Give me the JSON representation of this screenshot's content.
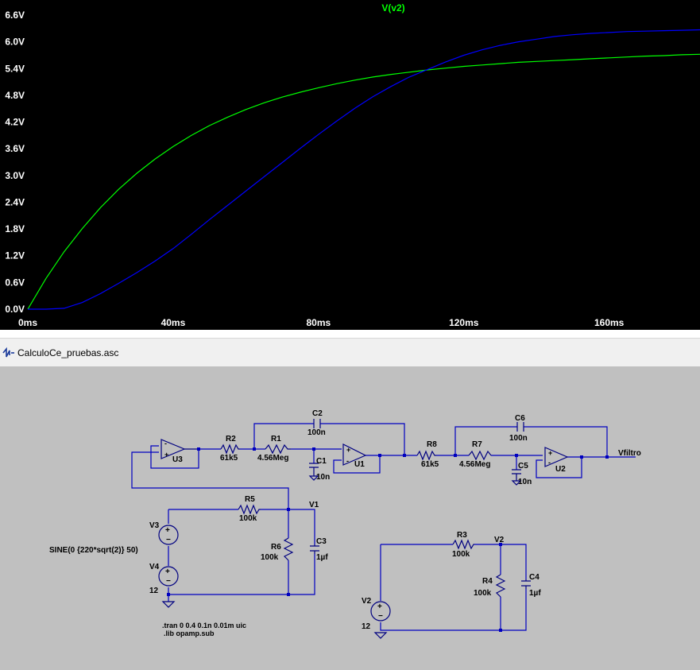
{
  "waveform": {
    "trace_title": "V(v2)",
    "background": "#000000",
    "trace_title_color": "#00ff00",
    "chart_data": {
      "type": "line",
      "title": "V(v2)",
      "xlabel": "",
      "ylabel": "",
      "xlim": [
        0,
        185
      ],
      "ylim": [
        0,
        6.6
      ],
      "x_ticks": [
        "0ms",
        "40ms",
        "80ms",
        "120ms",
        "160ms"
      ],
      "y_ticks": [
        "0.0V",
        "0.6V",
        "1.2V",
        "1.8V",
        "2.4V",
        "3.0V",
        "3.6V",
        "4.2V",
        "4.8V",
        "5.4V",
        "6.0V",
        "6.6V"
      ],
      "grid": false,
      "series": [
        {
          "color": "#00ff00",
          "x": [
            0,
            5,
            10,
            15,
            20,
            25,
            30,
            35,
            40,
            45,
            50,
            55,
            60,
            65,
            70,
            75,
            80,
            85,
            90,
            95,
            100,
            105,
            110,
            115,
            120,
            125,
            130,
            135,
            140,
            145,
            150,
            155,
            160,
            165,
            170,
            175,
            180,
            185
          ],
          "values": [
            0,
            0.69,
            1.29,
            1.81,
            2.28,
            2.69,
            3.05,
            3.37,
            3.65,
            3.9,
            4.12,
            4.31,
            4.48,
            4.63,
            4.76,
            4.87,
            4.97,
            5.06,
            5.14,
            5.21,
            5.27,
            5.32,
            5.37,
            5.41,
            5.45,
            5.48,
            5.51,
            5.54,
            5.56,
            5.58,
            5.6,
            5.62,
            5.64,
            5.66,
            5.68,
            5.69,
            5.71,
            5.72
          ]
        },
        {
          "color": "#0000ff",
          "x": [
            0,
            5,
            10,
            15,
            20,
            25,
            30,
            35,
            40,
            45,
            50,
            55,
            60,
            65,
            70,
            75,
            80,
            85,
            90,
            95,
            100,
            105,
            110,
            115,
            120,
            125,
            130,
            135,
            140,
            145,
            150,
            155,
            160,
            165,
            170,
            175,
            180,
            185
          ],
          "values": [
            0,
            0,
            0.02,
            0.15,
            0.35,
            0.58,
            0.82,
            1.08,
            1.36,
            1.68,
            2.01,
            2.33,
            2.65,
            2.97,
            3.29,
            3.61,
            3.92,
            4.22,
            4.51,
            4.77,
            5.0,
            5.21,
            5.38,
            5.55,
            5.7,
            5.82,
            5.92,
            6.0,
            6.06,
            6.12,
            6.16,
            6.19,
            6.21,
            6.23,
            6.24,
            6.25,
            6.26,
            6.27
          ]
        }
      ]
    }
  },
  "tab": {
    "icon": "waveform-icon",
    "title": "CalculoCe_pruebas.asc"
  },
  "schematic": {
    "components": {
      "u3": "U3",
      "u1": "U1",
      "u2": "U2",
      "r2": "R2",
      "r2_val": "61k5",
      "r1": "R1",
      "r1_val": "4.56Meg",
      "c2": "C2",
      "c2_val": "100n",
      "c1": "C1",
      "c1_val": "10n",
      "r8": "R8",
      "r8_val": "61k5",
      "r7": "R7",
      "r7_val": "4.56Meg",
      "c6": "C6",
      "c6_val": "100n",
      "c5": "C5",
      "c5_val": "10n",
      "r5": "R5",
      "r5_val": "100k",
      "r6": "R6",
      "r6_val": "100k",
      "c3": "C3",
      "c3_val": "1µf",
      "v3": "V3",
      "v3_val": "SINE(0 {220*sqrt(2)} 50)",
      "v4": "V4",
      "v4_val": "12",
      "r3": "R3",
      "r3_val": "100k",
      "r4": "R4",
      "r4_val": "100k",
      "c4": "C4",
      "c4_val": "1µf",
      "v2": "V2",
      "v2_val": "12"
    },
    "nets": {
      "v1": "V1",
      "v2": "V2",
      "vfiltro": "Vfiltro"
    },
    "directives": {
      "tran": ".tran 0 0.4 0.1n 0.01m uic",
      "lib": ".lib opamp.sub"
    }
  }
}
